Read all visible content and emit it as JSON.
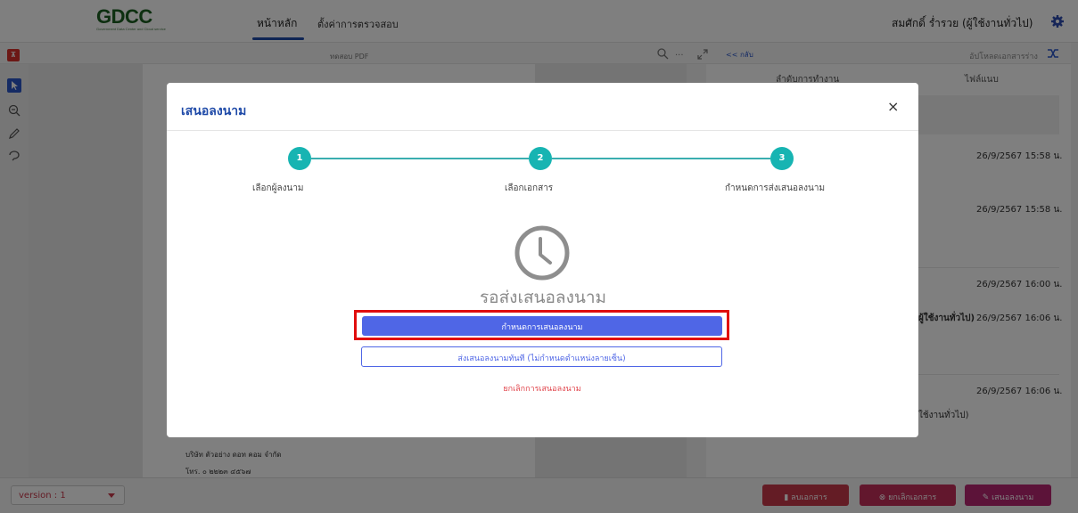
{
  "header": {
    "logo": "GDCC",
    "logo_sub": "Government Data Center and Cloud service",
    "nav": [
      "หน้าหลัก",
      "ตั้งค่าการตรวจสอบ"
    ],
    "user": "สมศักดิ์ ร่ำรวย (ผู้ใช้งานทั่วไป)"
  },
  "toolbar": {
    "doc_title": "ทดสอบ PDF",
    "more": "...",
    "back": "<< กลับ",
    "upload": "อัปโหลดเอกสารร่าง"
  },
  "document": {
    "company": "บริษัท ตัวอย่าง ดอท คอม จำกัด",
    "phone": "โทร. ๐ ๒๒๒๓ ๔๕๖๗"
  },
  "right_panel": {
    "col_order": "ลำดับการทำงาน",
    "col_attach": "ไฟล์แนบ",
    "timestamps": [
      "26/9/2567 15:58 น.",
      "26/9/2567 15:58 น.",
      "26/9/2567 16:00 น.",
      "26/9/2567 16:06 น.",
      "26/9/2567 16:06 น."
    ],
    "bold_fragment": "ผู้ใช้งานทั่วไป)",
    "fragment": "ใช้งานทั่วไป)"
  },
  "modal": {
    "title": "เสนอลงนาม",
    "close": "×",
    "steps": [
      {
        "num": "1",
        "label": "เลือกผู้ลงนาม"
      },
      {
        "num": "2",
        "label": "เลือกเอกสาร"
      },
      {
        "num": "3",
        "label": "กำหนดการส่งเสนอลงนาม"
      }
    ],
    "status": "รอส่งเสนอลงนาม",
    "primary_button": "กำหนดการเสนอลงนาม",
    "secondary_button": "ส่งเสนอลงนามทันที (ไม่กำหนดตำแหน่งลายเซ็น)",
    "cancel_link": "ยกเลิกการเสนอลงนาม"
  },
  "bottom": {
    "version": "version : 1",
    "delete": "ลบเอกสาร",
    "cancel_doc": "ยกเลิกเอกสาร",
    "propose": "เสนอลงนาม"
  },
  "colors": {
    "accent": "#4f66e6",
    "teal": "#17b4b2",
    "danger": "#c9384b",
    "highlight": "#e00d0d"
  }
}
